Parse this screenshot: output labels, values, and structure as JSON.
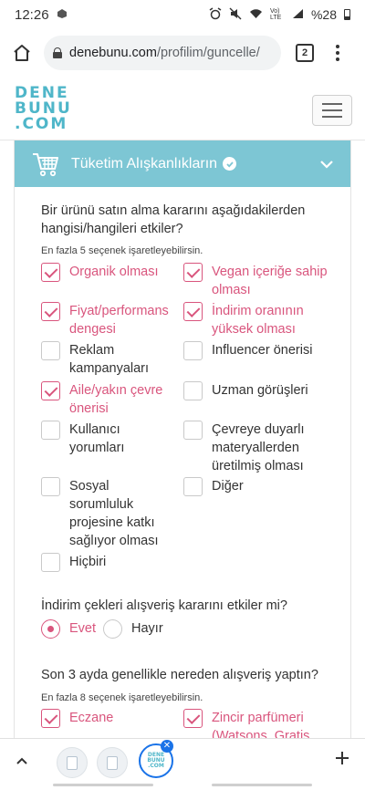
{
  "status_bar": {
    "time": "12:26",
    "battery": "%28",
    "network": "Vo) LTE"
  },
  "browser": {
    "url_host": "denebunu.com",
    "url_path": "/profilim/guncelle/",
    "tab_count": "2"
  },
  "site": {
    "logo_lines": [
      "DENE",
      "BUNU",
      ".COM"
    ]
  },
  "section": {
    "title": "Tüketim Alışkanlıkların"
  },
  "q1": {
    "question": "Bir ürünü satın alma kararını aşağıdakilerden hangisi/hangileri etkiler?",
    "hint": "En fazla 5 seçenek işaretleyebilirsin.",
    "options": [
      {
        "label": "Organik olması",
        "checked": true
      },
      {
        "label": "Vegan içeriğe sahip olması",
        "checked": true
      },
      {
        "label": "Fiyat/performans dengesi",
        "checked": true
      },
      {
        "label": "İndirim oranının yüksek olması",
        "checked": true
      },
      {
        "label": "Reklam kampanyaları",
        "checked": false
      },
      {
        "label": "Influencer önerisi",
        "checked": false
      },
      {
        "label": "Aile/yakın çevre önerisi",
        "checked": true
      },
      {
        "label": "Uzman görüşleri",
        "checked": false
      },
      {
        "label": "Kullanıcı yorumları",
        "checked": false
      },
      {
        "label": "Çevreye duyarlı materyallerden üretilmiş olması",
        "checked": false
      },
      {
        "label": "Sosyal sorumluluk projesine katkı sağlıyor olması",
        "checked": false
      },
      {
        "label": "Diğer",
        "checked": false
      },
      {
        "label": "Hiçbiri",
        "checked": false
      }
    ]
  },
  "q2": {
    "question": "İndirim çekleri alışveriş kararını etkiler mi?",
    "options": [
      {
        "label": "Evet",
        "selected": true
      },
      {
        "label": "Hayır",
        "selected": false
      }
    ]
  },
  "q3": {
    "question": "Son 3 ayda genellikle nereden alışveriş yaptın?",
    "hint": "En fazla 8 seçenek işaretleyebilirsin.",
    "options": [
      {
        "label": "Eczane",
        "checked": true
      },
      {
        "label": "Zincir parfümeri (Watsons, Gratis",
        "checked": true
      }
    ]
  },
  "colors": {
    "accent": "#d9557d",
    "header_teal": "#7dc6d4",
    "logo_teal": "#4fb6c9",
    "chrome_blue": "#1a73e8"
  }
}
